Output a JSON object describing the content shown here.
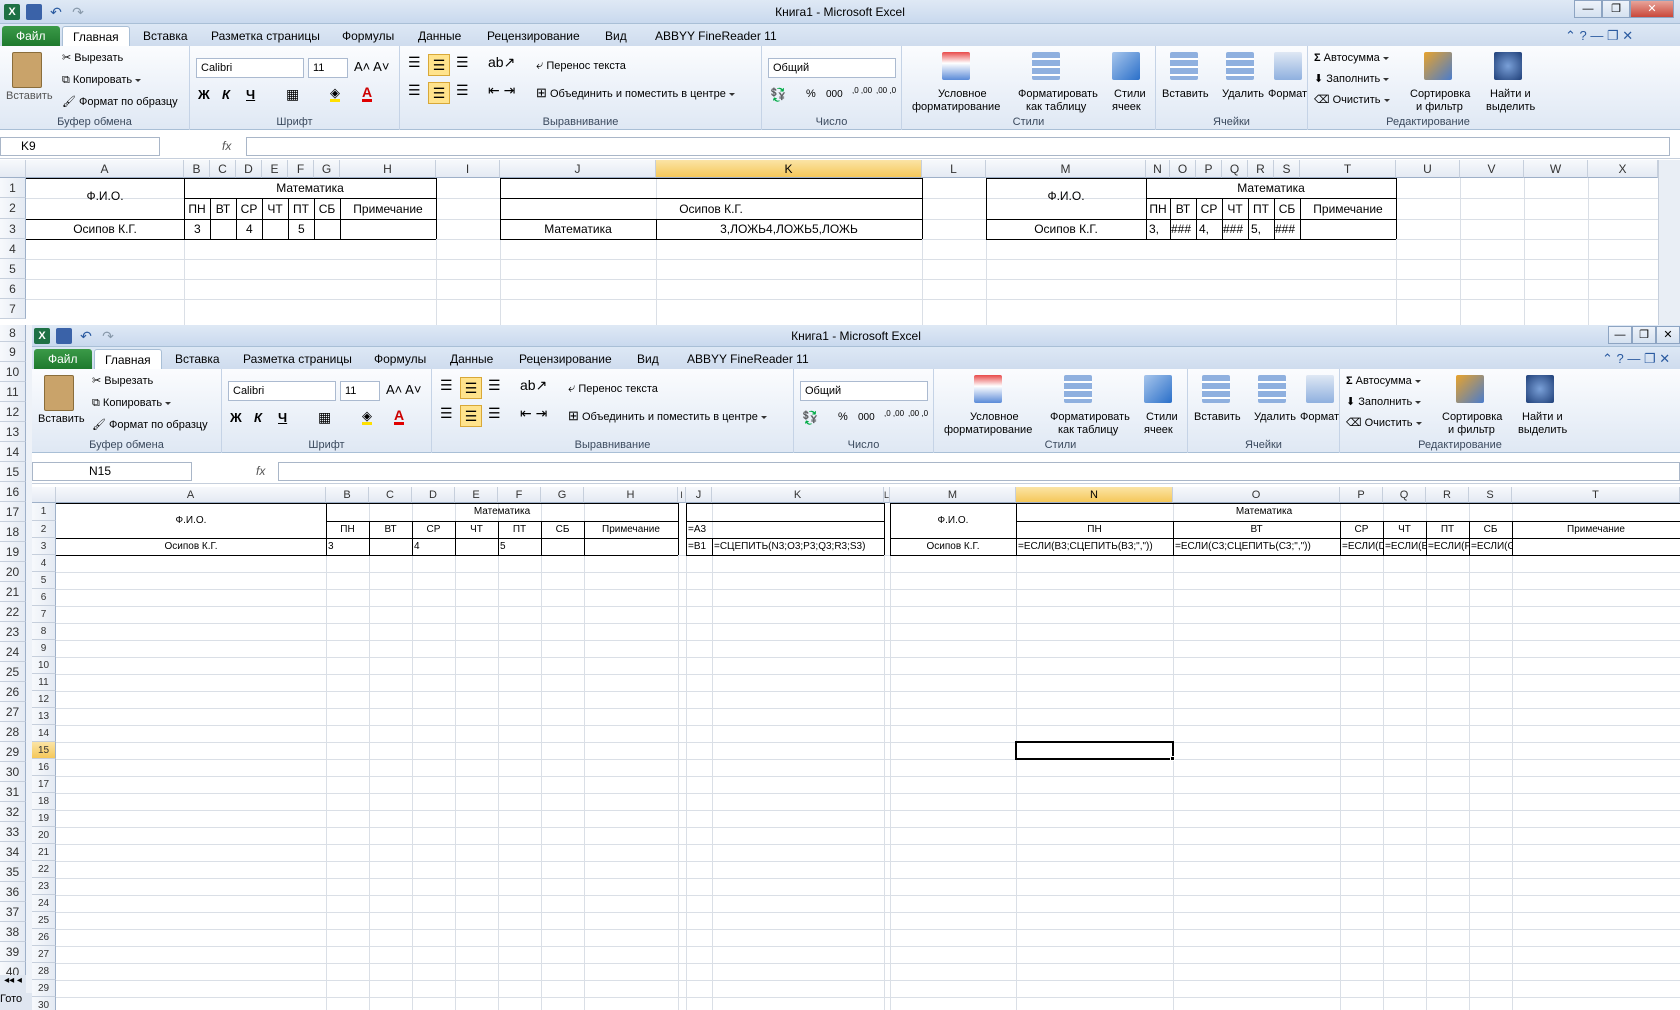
{
  "window": {
    "title": "Книга1  -  Microsoft Excel"
  },
  "ribbon_tabs": [
    "Файл",
    "Главная",
    "Вставка",
    "Разметка страницы",
    "Формулы",
    "Данные",
    "Рецензирование",
    "Вид",
    "ABBYY FineReader 11"
  ],
  "ribbon": {
    "clipboard": {
      "paste": "Вставить",
      "cut": "Вырезать",
      "copy": "Копировать",
      "format": "Формат по образцу",
      "group": "Буфер обмена"
    },
    "font": {
      "name": "Calibri",
      "size": "11",
      "group": "Шрифт",
      "bold": "Ж",
      "italic": "К",
      "underline": "Ч",
      "grow": "A",
      "color": "A"
    },
    "alignment": {
      "wrap": "Перенос текста",
      "merge": "Объединить и поместить в центре",
      "group": "Выравнивание"
    },
    "number": {
      "format": "Общий",
      "percent": "%",
      "thousands": "000",
      "dec_inc": ",0 ,00",
      "dec_dec": ",00 ,0",
      "group": "Число"
    },
    "styles": {
      "conditional": "Условное",
      "conditional2": "форматирование",
      "as_table": "Форматировать",
      "as_table2": "как таблицу",
      "cell_styles": "Стили",
      "cell_styles2": "ячеек",
      "group": "Стили"
    },
    "cells": {
      "insert": "Вставить",
      "delete": "Удалить",
      "format": "Формат",
      "group": "Ячейки"
    },
    "editing": {
      "autosum": "Автосумма",
      "fill": "Заполнить",
      "clear": "Очистить",
      "sort": "Сортировка",
      "sort2": "и фильтр",
      "find": "Найти и",
      "find2": "выделить",
      "group": "Редактирование",
      "sigma": "Σ"
    }
  },
  "top": {
    "namebox": "K9",
    "fx": "fx",
    "columns": [
      "A",
      "B",
      "C",
      "D",
      "E",
      "F",
      "G",
      "H",
      "I",
      "J",
      "K",
      "L",
      "M",
      "N",
      "O",
      "P",
      "Q",
      "R",
      "S",
      "T",
      "U",
      "V",
      "W",
      "X"
    ],
    "rows": [
      "1",
      "2",
      "3",
      "4",
      "5",
      "6",
      "7",
      "8",
      "9",
      "10",
      "11",
      "12",
      "13",
      "14",
      "15",
      "16",
      "17",
      "18",
      "19",
      "20",
      "21",
      "22",
      "23",
      "24",
      "25",
      "26",
      "27",
      "28",
      "29",
      "30",
      "31",
      "32",
      "33",
      "34",
      "35",
      "36",
      "37",
      "38",
      "39",
      "40"
    ],
    "cells": {
      "fio": "Ф.И.О.",
      "math": "Математика",
      "days": [
        "ПН",
        "ВТ",
        "СР",
        "ЧТ",
        "ПТ",
        "СБ"
      ],
      "note": "Примечание",
      "name": "Осипов К.Г.",
      "b3": "3",
      "d3": "4",
      "f3": "5",
      "j2k2": "Осипов К.Г.",
      "j3": "Математика",
      "k3": "3,ЛОЖЬ4,ЛОЖЬ5,ЛОЖЬ",
      "m_fio": "Ф.И.О.",
      "m_math": "Математика",
      "m_name": "Осипов К.Г.",
      "m_vals": [
        "3,",
        "###",
        "4,",
        "###",
        "5,",
        "###"
      ]
    },
    "sheet_nav": "Гото"
  },
  "bottom": {
    "title": "Книга1  -  Microsoft Excel",
    "namebox": "N15",
    "fx": "fx",
    "columns": [
      "A",
      "B",
      "C",
      "D",
      "E",
      "F",
      "G",
      "H",
      "I",
      "J",
      "K",
      "L",
      "M",
      "N",
      "O",
      "P",
      "Q",
      "R",
      "S",
      "T"
    ],
    "rows": [
      "1",
      "2",
      "3",
      "4",
      "5",
      "6",
      "7",
      "8",
      "9",
      "10",
      "11",
      "12",
      "13",
      "14",
      "15",
      "16",
      "17",
      "18",
      "19",
      "20",
      "21",
      "22",
      "23",
      "24",
      "25",
      "26",
      "27",
      "28",
      "29",
      "30"
    ],
    "cells": {
      "fio": "Ф.И.О.",
      "math": "Математика",
      "days": [
        "ПН",
        "ВТ",
        "СР",
        "ЧТ",
        "ПТ",
        "СБ"
      ],
      "note": "Примечание",
      "name": "Осипов К.Г.",
      "b3": "3",
      "d3": "4",
      "f3": "5",
      "j2": "=A3",
      "j3": "=B1",
      "k3": "=СЦЕПИТЬ(N3;O3;P3;Q3;R3;S3)",
      "m_fio": "Ф.И.О.",
      "m_math": "Математика",
      "m_days": [
        "ПН",
        "ВТ",
        "СР",
        "ЧТ",
        "ПТ",
        "СБ"
      ],
      "m_note": "Примечание",
      "m_name": "Осипов К.Г.",
      "n3": "=ЕСЛИ(B3;СЦЕПИТЬ(B3;\",\"))",
      "o3": "=ЕСЛИ(C3;СЦЕПИТЬ(C3;\",\"))",
      "p3": "=ЕСЛИ(D",
      "q3": "=ЕСЛИ(E",
      "r3": "=ЕСЛИ(F",
      "s3": "=ЕСЛИ(G"
    }
  }
}
